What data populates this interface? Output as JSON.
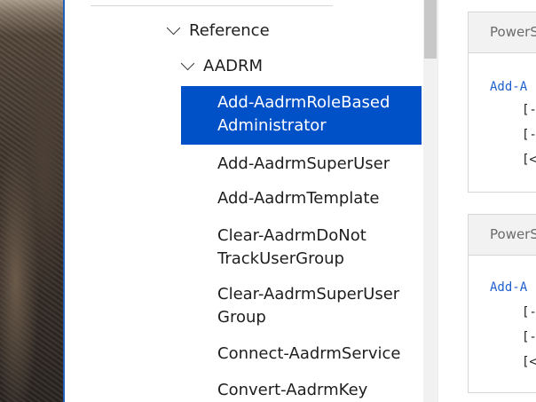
{
  "nav": {
    "tree": {
      "reference": "Reference",
      "aadrm": "AADRM"
    },
    "items": [
      {
        "label_line1": "Add-AadrmRoleBased",
        "label_line2": "Administrator",
        "selected": true
      },
      {
        "label": "Add-AadrmSuperUser"
      },
      {
        "label": "Add-AadrmTemplate"
      },
      {
        "label_line1": "Clear-AadrmDoNot",
        "label_line2": "TrackUserGroup"
      },
      {
        "label_line1": "Clear-AadrmSuperUser",
        "label_line2": "Group"
      },
      {
        "label": "Connect-AadrmService"
      },
      {
        "label": "Convert-AadrmKey"
      }
    ]
  },
  "content": {
    "cards": [
      {
        "header": "PowerS",
        "cmd": "Add-A",
        "lines": [
          "[-",
          "[-",
          "[<"
        ]
      },
      {
        "header": "PowerS",
        "cmd": "Add-A",
        "lines": [
          "[-",
          "[-",
          "[<"
        ]
      }
    ]
  },
  "colors": {
    "selected_bg": "#0050c8",
    "link": "#1f5fcc"
  }
}
